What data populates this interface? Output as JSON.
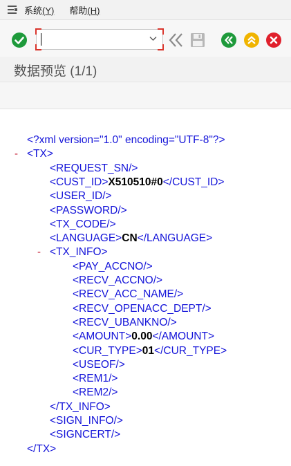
{
  "menu": {
    "items": [
      {
        "label": "系统",
        "accel": "(Y)"
      },
      {
        "label": "帮助",
        "accel": "(H)"
      }
    ]
  },
  "toolbar": {
    "command_value": ""
  },
  "title": "数据预览 (1/1)",
  "xml": {
    "lines": [
      {
        "indent": 0,
        "text": "<?xml version=\"1.0\" encoding=\"UTF-8\"?>"
      },
      {
        "indent": 0,
        "toggle": "-",
        "text": "<TX>"
      },
      {
        "indent": 1,
        "text": "<REQUEST_SN/>"
      },
      {
        "indent": 1,
        "open": "<CUST_ID>",
        "value": "X510510#0",
        "close": "</CUST_ID>"
      },
      {
        "indent": 1,
        "text": "<USER_ID/>"
      },
      {
        "indent": 1,
        "text": "<PASSWORD/>"
      },
      {
        "indent": 1,
        "text": "<TX_CODE/>"
      },
      {
        "indent": 1,
        "open": "<LANGUAGE>",
        "value": "CN",
        "close": "</LANGUAGE>"
      },
      {
        "indent": 1,
        "toggle": "-",
        "text": "<TX_INFO>"
      },
      {
        "indent": 2,
        "text": "<PAY_ACCNO/>"
      },
      {
        "indent": 2,
        "text": "<RECV_ACCNO/>"
      },
      {
        "indent": 2,
        "text": "<RECV_ACC_NAME/>"
      },
      {
        "indent": 2,
        "text": "<RECV_OPENACC_DEPT/>"
      },
      {
        "indent": 2,
        "text": "<RECV_UBANKNO/>"
      },
      {
        "indent": 2,
        "open": "<AMOUNT>",
        "value": "0.00",
        "close": "</AMOUNT>"
      },
      {
        "indent": 2,
        "open": "<CUR_TYPE>",
        "value": "01",
        "close": "</CUR_TYPE>"
      },
      {
        "indent": 2,
        "text": "<USEOF/>"
      },
      {
        "indent": 2,
        "text": "<REM1/>"
      },
      {
        "indent": 2,
        "text": "<REM2/>"
      },
      {
        "indent": 1,
        "text": "</TX_INFO>"
      },
      {
        "indent": 1,
        "text": "<SIGN_INFO/>"
      },
      {
        "indent": 1,
        "text": "<SIGNCERT/>"
      },
      {
        "indent": 0,
        "text": "</TX>"
      }
    ]
  },
  "colors": {
    "tag": "#1414d9",
    "value": "#000000",
    "toggle": "#c3172e",
    "ok_green": "#1e9a3b",
    "nav_yellow": "#f0b400",
    "cancel_red": "#e0202c"
  },
  "icons": [
    "menu-icon",
    "check-icon",
    "double-chevron-left-icon",
    "save-icon",
    "back-icon",
    "up-icon",
    "cancel-icon"
  ]
}
